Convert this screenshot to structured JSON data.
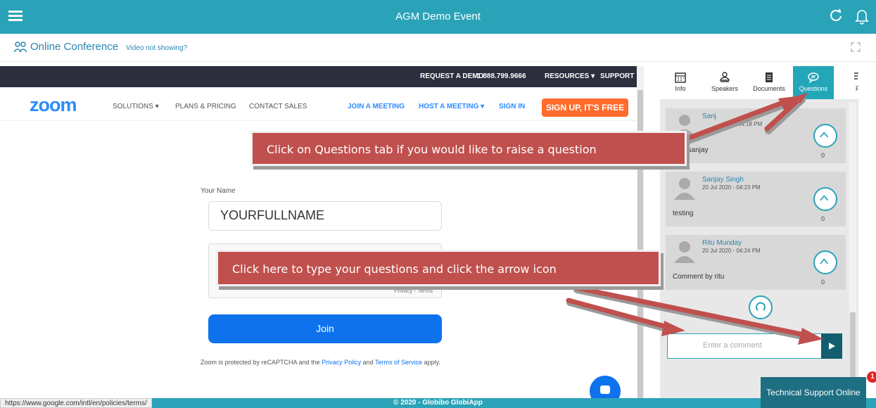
{
  "app": {
    "title": "AGM Demo Event"
  },
  "subheader": {
    "title": "Online Conference",
    "video_link": "Video not showing?"
  },
  "zoom": {
    "top_links": [
      "REQUEST A DEMO",
      "1.888.799.9666",
      "RESOURCES ▾",
      "SUPPORT"
    ],
    "logo": "zoom",
    "nav": [
      "SOLUTIONS ▾",
      "PLANS & PRICING",
      "CONTACT SALES",
      "JOIN A MEETING",
      "HOST A MEETING ▾",
      "SIGN IN"
    ],
    "signup": "SIGN UP, IT'S FREE",
    "name_label": "Your Name",
    "name_value": "YOURFULLNAME",
    "captcha_terms": "Privacy - Terms",
    "join_label": "Join",
    "recaptcha_prefix": "Zoom is protected by reCAPTCHA and the",
    "privacy_link": "Privacy Policy",
    "and_text": "and",
    "terms_link": "Terms of Service",
    "apply_text": "apply."
  },
  "panel": {
    "tabs": [
      {
        "label": "Info",
        "icon": "calendar-icon"
      },
      {
        "label": "Speakers",
        "icon": "speakers-icon"
      },
      {
        "label": "Documents",
        "icon": "document-icon"
      },
      {
        "label": "Questions",
        "icon": "chat-icon",
        "active": true
      },
      {
        "label": "P",
        "icon": "poll-icon"
      }
    ],
    "questions": [
      {
        "name": "Sanj",
        "date": "- 04:18 PM",
        "text": "g by sanjay",
        "votes": "0"
      },
      {
        "name": "Sanjay Singh",
        "date": "20 Jul 2020 - 04:23 PM",
        "text": "testing",
        "votes": "0"
      },
      {
        "name": "Ritu Munday",
        "date": "20 Jul 2020 - 04:24 PM",
        "text": "Comment by ritu",
        "votes": "0"
      }
    ],
    "comment_placeholder": "Enter a comment"
  },
  "footer": {
    "text": "© 2020 - Globibo GlobiApp",
    "status_url": "https://www.google.com/intl/en/policies/terms/"
  },
  "support": {
    "label": "Technical Support Online",
    "badge": "1"
  },
  "callouts": {
    "questions_tab": "Click on Questions tab if you would like to raise a question",
    "type_here": "Click here to type your questions and click the arrow icon"
  },
  "colors": {
    "brand": "#2aa3b8",
    "callout": "#c0504d",
    "zoom_blue": "#0e72ed",
    "zoom_orange": "#ff6c2c"
  }
}
